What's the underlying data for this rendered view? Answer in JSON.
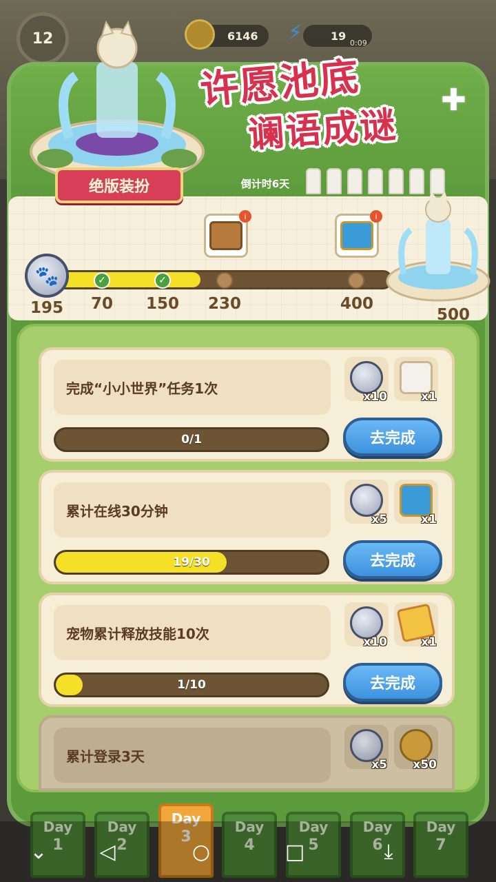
{
  "hud": {
    "level": "12",
    "coins": "6146",
    "energy": "19",
    "energy_timer": "0:09",
    "colors": {
      "coin": "#b08a2c",
      "energy": "#3c8fd8"
    }
  },
  "event": {
    "title_line1": "许愿池底",
    "title_line2": "谰语成谜",
    "ribbon": "绝版装扮",
    "countdown": "倒计时6天",
    "colors": {
      "title": "#d8314d",
      "ribbon": "#d83e57",
      "panel": "#5d9a3c"
    }
  },
  "milestones": {
    "current_points": "195",
    "progress_fraction": 0.43,
    "nodes": [
      {
        "value": "70",
        "status": "done"
      },
      {
        "value": "150",
        "status": "done"
      },
      {
        "value": "230",
        "status": "locked",
        "reward": "wooden-chest-icon"
      },
      {
        "value": "400",
        "status": "locked",
        "reward": "blue-chest-icon"
      },
      {
        "value": "500",
        "status": "locked",
        "reward": "fountain-icon"
      }
    ]
  },
  "tasks": [
    {
      "description": "完成“小小世界”任务1次",
      "progress_text": "0/1",
      "progress_fraction": 0,
      "rewards": [
        {
          "icon": "paw-coin-icon",
          "count": "x10"
        },
        {
          "icon": "hourglass-icon",
          "count": "x1"
        }
      ],
      "button": "去完成"
    },
    {
      "description": "累计在线30分钟",
      "progress_text": "19/30",
      "progress_fraction": 0.63,
      "rewards": [
        {
          "icon": "paw-coin-icon",
          "count": "x5"
        },
        {
          "icon": "treasure-chest-icon",
          "count": "x1"
        }
      ],
      "button": "去完成"
    },
    {
      "description": "宠物累计释放技能10次",
      "progress_text": "1/10",
      "progress_fraction": 0.1,
      "rewards": [
        {
          "icon": "paw-coin-icon",
          "count": "x10"
        },
        {
          "icon": "ticket-card-icon",
          "count": "x1"
        }
      ],
      "button": "去完成"
    },
    {
      "description": "累计登录3天",
      "rewards": [
        {
          "icon": "paw-coin-icon",
          "count": "x5"
        },
        {
          "icon": "gold-coins-icon",
          "count": "x50"
        }
      ]
    }
  ],
  "days": [
    {
      "label": "Day",
      "num": "1"
    },
    {
      "label": "Day",
      "num": "2"
    },
    {
      "label": "Day",
      "num": "3"
    },
    {
      "label": "Day",
      "num": "4"
    },
    {
      "label": "Day",
      "num": "5"
    },
    {
      "label": "Day",
      "num": "6"
    },
    {
      "label": "Day",
      "num": "7"
    }
  ],
  "active_day": "3"
}
